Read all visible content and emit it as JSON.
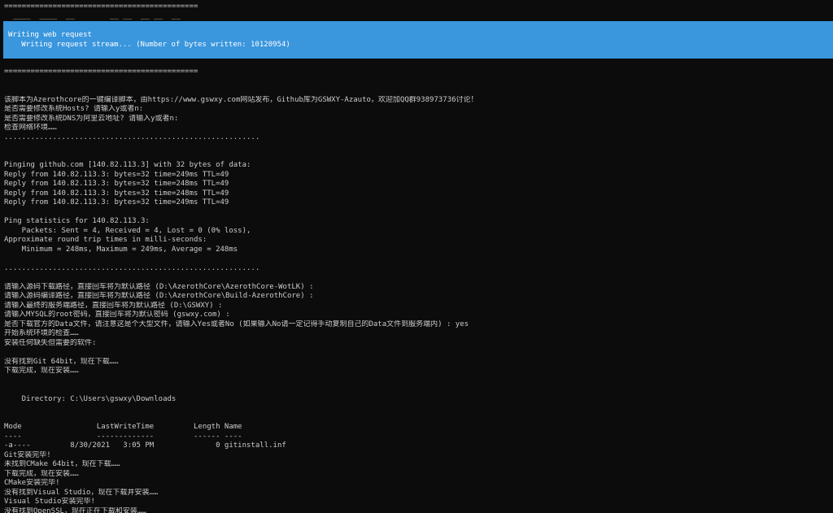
{
  "terminal": {
    "top_lines": [
      "============================================",
      "  ____  ____  __        __ __  __ __  __"
    ],
    "progress": {
      "title": "Writing web request",
      "status": "   Writing request stream... (Number of bytes written: 10120954)"
    },
    "output_lines": [
      "============================================",
      "",
      "",
      "该脚本为Azerothcore的一键编译脚本，由https://www.gswxy.com网站发布，Github库为GSWXY-Azauto，欢迎加QQ群938973736讨论！",
      "是否需要修改系统Hosts? 请输入y或者n:",
      "是否需要修改系统DNS为阿里云地址? 请输入y或者n:",
      "检查网络环境……",
      "..........................................................",
      "",
      "",
      "Pinging github.com [140.82.113.3] with 32 bytes of data:",
      "Reply from 140.82.113.3: bytes=32 time=249ms TTL=49",
      "Reply from 140.82.113.3: bytes=32 time=248ms TTL=49",
      "Reply from 140.82.113.3: bytes=32 time=248ms TTL=49",
      "Reply from 140.82.113.3: bytes=32 time=249ms TTL=49",
      "",
      "Ping statistics for 140.82.113.3:",
      "    Packets: Sent = 4, Received = 4, Lost = 0 (0% loss),",
      "Approximate round trip times in milli-seconds:",
      "    Minimum = 248ms, Maximum = 249ms, Average = 248ms",
      "",
      "..........................................................",
      "",
      "请输入源码下载路径，直接回车将为默认路径 (D:\\AzerothCore\\AzerothCore-WotLK) :",
      "请输入源码编译路径，直接回车将为默认路径 (D:\\AzerothCore\\Build-AzerothCore) :",
      "请输入最终的服务端路径，直接回车将为默认路径 (D:\\GSWXY) :",
      "请输入MYSQL的root密码，直接回车将为默认密码 (gswxy.com) :",
      "是否下载官方的Data文件，请注意这是个大型文件，请输入Yes或者No (如果输入No请一定记得手动复制自己的Data文件到服务端内) : yes",
      "开始系统环境的检查……",
      "安装任何缺失但需要的软件:",
      "",
      "没有找到Git 64bit，现在下载……",
      "下载完成，现在安装……",
      "",
      "",
      "    Directory: C:\\Users\\gswxy\\Downloads",
      "",
      "",
      "Mode                 LastWriteTime         Length Name",
      "----                 -------------         ------ ----",
      "-a----         8/30/2021   3:05 PM              0 gitinstall.inf",
      "Git安装完毕!",
      "未找到CMake 64bit，现在下载……",
      "下载完成，现在安装……",
      "CMake安装完毕!",
      "没有找到Visual Studio，现在下载并安装……",
      "Visual Studio安装完毕!",
      "没有找到OpenSSL，现在正在下载和安装……"
    ]
  }
}
